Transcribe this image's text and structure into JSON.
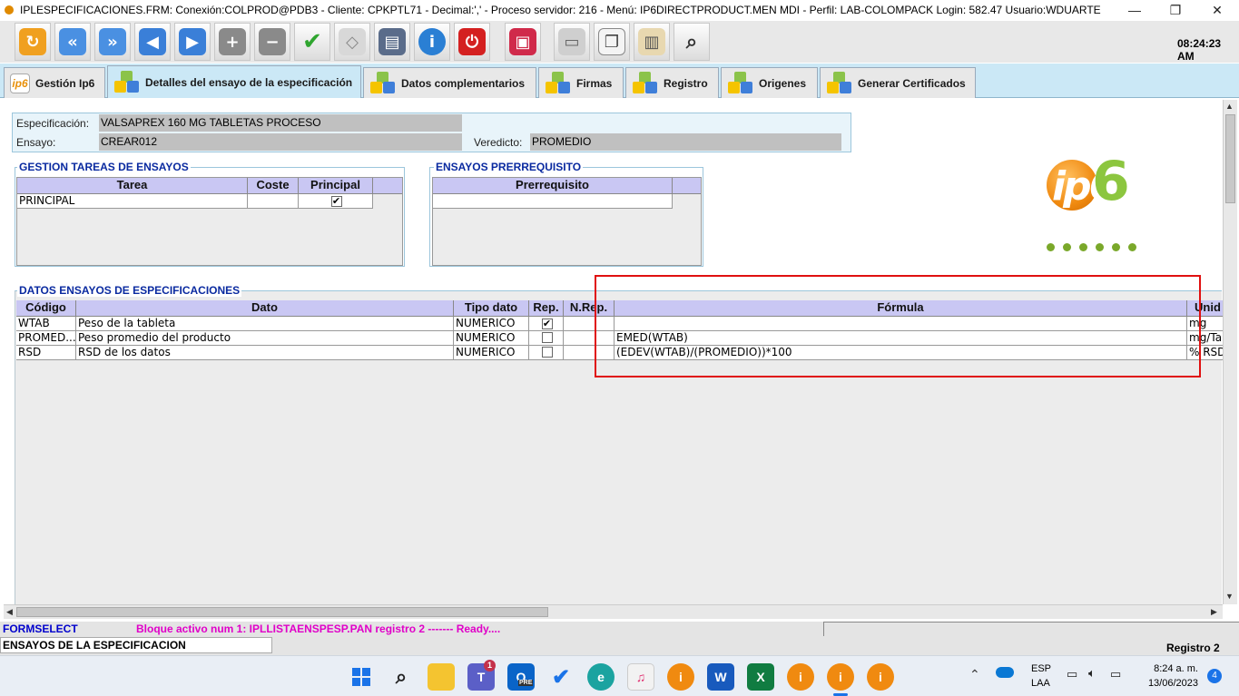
{
  "window": {
    "title": "IPLESPECIFICACIONES.FRM:      Conexión:COLPROD@PDB3 - Cliente: CPKPTL71 - Decimal:',' - Proceso servidor: 216 - Menú: IP6DIRECTPRODUCT.MEN MDI - Perfil: LAB-COLOMPACK Login: 582.47       Usuario:WDUARTE",
    "minimize": "—",
    "maximize": "❐",
    "close": "✕"
  },
  "toolbar": {
    "clock": "08:24:23 AM",
    "icons": [
      "refresh-icon",
      "first-record-icon",
      "last-record-icon",
      "previous-icon",
      "next-icon",
      "insert-record-icon",
      "delete-record-icon",
      "accept-icon",
      "clear-icon",
      "print-icon",
      "info-icon",
      "power-icon",
      "lock-icon",
      "eraser-icon",
      "copy-icon",
      "paste-icon",
      "search-icon"
    ]
  },
  "tabs": [
    {
      "label": "Gestión Ip6",
      "icon": "ip6-logo-icon"
    },
    {
      "label": "Detalles del ensayo de la especificación",
      "icon": "cubes-icon",
      "active": true
    },
    {
      "label": "Datos complementarios",
      "icon": "cubes-icon"
    },
    {
      "label": "Firmas",
      "icon": "cubes-icon"
    },
    {
      "label": "Registro",
      "icon": "cubes-icon"
    },
    {
      "label": "Origenes",
      "icon": "cubes-icon"
    },
    {
      "label": "Generar Certificados",
      "icon": "cubes-icon"
    }
  ],
  "header": {
    "especificacion_label": "Especificación:",
    "especificacion_value": "VALSAPREX 160 MG  TABLETAS PROCESO",
    "ensayo_label": "Ensayo:",
    "ensayo_value": "CREAR012",
    "veredicto_label": "Veredicto:",
    "veredicto_value": "PROMEDIO"
  },
  "tareas": {
    "title": "GESTION TAREAS DE ENSAYOS",
    "columns": [
      "Tarea",
      "Coste",
      "Principal"
    ],
    "rows": [
      {
        "tarea": "PRINCIPAL",
        "coste": "",
        "principal": "✔"
      }
    ]
  },
  "prerrequisitos": {
    "title": "ENSAYOS PRERREQUISITO",
    "columns": [
      "Prerrequisito"
    ]
  },
  "logo": {
    "text": "ip6"
  },
  "datos": {
    "title": "DATOS ENSAYOS DE ESPECIFICACIONES",
    "columns": [
      "Código",
      "Dato",
      "Tipo dato",
      "Rep.",
      "N.Rep.",
      "Fórmula",
      "Unid"
    ],
    "rows": [
      {
        "codigo": "WTAB",
        "dato": "Peso de la tableta",
        "tipo": "NUMERICO",
        "rep": "✔",
        "nrep": "",
        "formula": "",
        "unid": "mg"
      },
      {
        "codigo": "PROMED...",
        "dato": "Peso promedio del producto",
        "tipo": "NUMERICO",
        "rep": "",
        "nrep": "",
        "formula": "EMED(WTAB)",
        "unid": "mg/Ta"
      },
      {
        "codigo": "RSD",
        "dato": "RSD de los datos",
        "tipo": "NUMERICO",
        "rep": "",
        "nrep": "",
        "formula": "(EDEV(WTAB)/(PROMEDIO))*100",
        "unid": "% RSD"
      }
    ]
  },
  "status": {
    "formselect": "FORMSELECT",
    "message": "Bloque activo num 1: IPLLISTAENSPESP.PAN  registro 2 ------- Ready....",
    "block_name": "ENSAYOS DE LA ESPECIFICACION",
    "registro": "Registro 2"
  },
  "taskbar": {
    "lang_top": "ESP",
    "lang_bottom": "LAA",
    "time": "8:24 a. m.",
    "date": "13/06/2023",
    "notifications": "4",
    "teams_badge": "1",
    "outlook_badge": "PRE"
  },
  "colors": {
    "tab_active": "#cbe8f6",
    "grid_header": "#c9c7f3",
    "group_title": "#0a2aa0",
    "highlight_box": "#e01010",
    "status_formselect": "#0000cc",
    "status_message": "#e000c8"
  }
}
